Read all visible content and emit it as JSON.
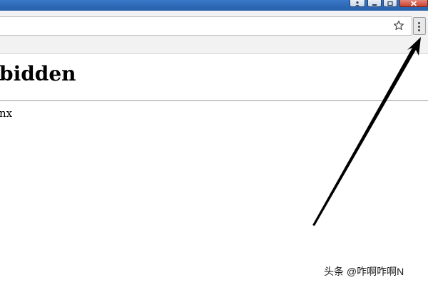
{
  "page": {
    "heading": "bidden",
    "footer_text": "nx"
  },
  "watermark": {
    "text": "头条 @咋啊咋啊N"
  },
  "icons": {
    "bookmark": "star-icon",
    "menu": "more-vert-icon",
    "user": "user-icon",
    "minimize": "minimize-icon",
    "maximize": "maximize-icon",
    "close": "close-icon"
  },
  "colors": {
    "titlebar": "#2d68b5",
    "close_button": "#c8422f",
    "toolbar": "#f2f2f2",
    "arrow": "#000000"
  }
}
